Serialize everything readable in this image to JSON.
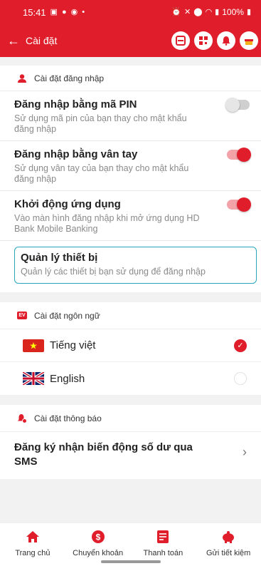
{
  "status": {
    "time": "15:41",
    "battery": "100%"
  },
  "header": {
    "title": "Cài đặt"
  },
  "login_section": {
    "heading": "Cài đặt đăng nhập",
    "pin": {
      "title": "Đăng nhập bằng mã PIN",
      "desc": "Sử dụng mã pin của bạn thay cho mật khẩu đăng nhập",
      "enabled": false
    },
    "fingerprint": {
      "title": "Đăng nhập bằng vân tay",
      "desc": "Sử dụng vân tay của bạn thay cho mật khẩu đăng nhập",
      "enabled": true
    },
    "launch": {
      "title": "Khởi động ứng dụng",
      "desc": "Vào màn hình đăng nhập khi mở ứng dụng HD Bank Mobile Banking",
      "enabled": true
    },
    "device": {
      "title": "Quản lý thiết bị",
      "desc": "Quản lý các thiết bị bạn sử dụng để đăng nhập"
    }
  },
  "language_section": {
    "heading": "Cài đặt ngôn ngữ",
    "badge": "EV",
    "options": [
      {
        "label": "Tiếng việt",
        "selected": true
      },
      {
        "label": "English",
        "selected": false
      }
    ]
  },
  "notify_section": {
    "heading": "Cài đặt thông báo",
    "item": "Đăng ký nhận biến động số dư qua SMS"
  },
  "bottom_nav": [
    {
      "label": "Trang chủ",
      "icon": "home-icon"
    },
    {
      "label": "Chuyển khoản",
      "icon": "transfer-icon"
    },
    {
      "label": "Thanh toán",
      "icon": "bill-icon"
    },
    {
      "label": "Gửi tiết kiệm",
      "icon": "piggy-bank-icon"
    }
  ],
  "colors": {
    "brand": "#e01e2b",
    "focus": "#2aa7bd"
  }
}
